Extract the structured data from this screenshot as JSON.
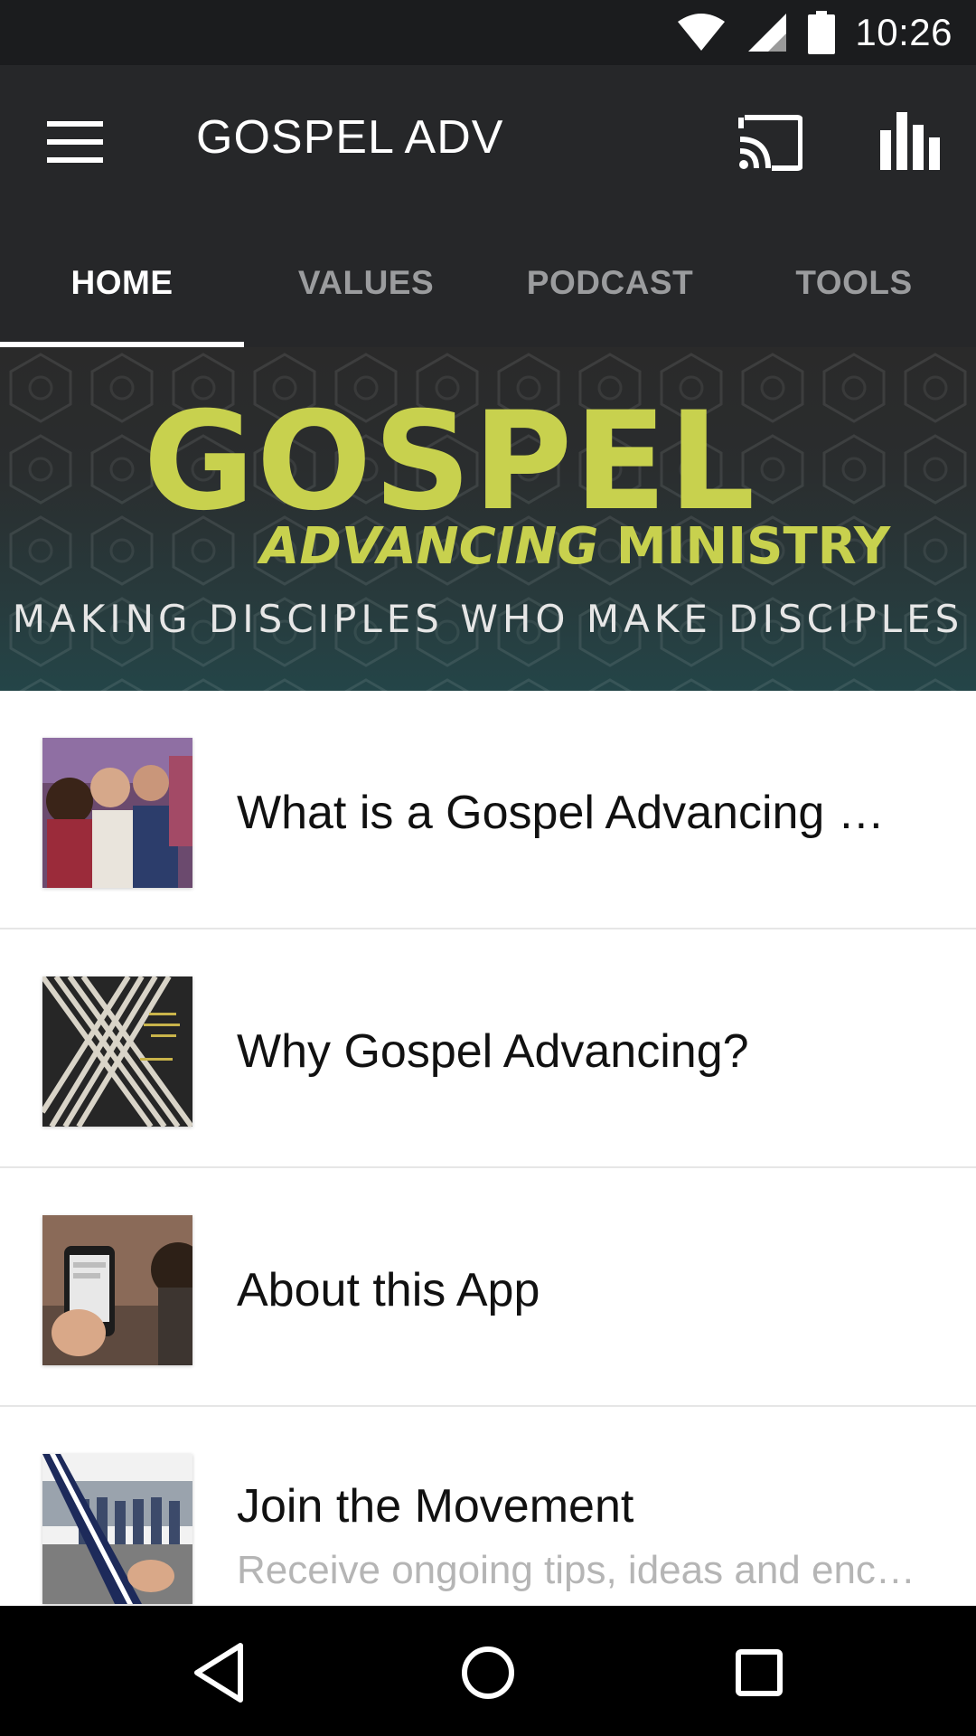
{
  "status_bar": {
    "time": "10:26",
    "icons": [
      "wifi-icon",
      "cell-signal-icon",
      "battery-icon"
    ]
  },
  "app_bar": {
    "title": "GOSPEL ADV",
    "icons": [
      "menu-icon",
      "cast-icon",
      "bar-chart-icon"
    ]
  },
  "tabs": [
    {
      "label": "HOME",
      "active": true
    },
    {
      "label": "VALUES",
      "active": false
    },
    {
      "label": "PODCAST",
      "active": false
    },
    {
      "label": "TOOLS",
      "active": false
    }
  ],
  "banner": {
    "title": "GOSPEL",
    "subtitle_italic": "ADVANCING",
    "subtitle_bold": " MINISTRY",
    "tagline": "MAKING DISCIPLES WHO MAKE DISCIPLES"
  },
  "list_items": [
    {
      "title": "What is a Gospel Advancing Ministry?",
      "subtitle": ""
    },
    {
      "title": "Why Gospel Advancing?",
      "subtitle": ""
    },
    {
      "title": "About this App",
      "subtitle": ""
    },
    {
      "title": "Join the Movement",
      "subtitle": "Receive ongoing tips, ideas and encouragement"
    }
  ],
  "nav_bar": {
    "icons": [
      "back-icon",
      "home-icon",
      "recents-icon"
    ]
  },
  "colors": {
    "app_bar": "#262729",
    "status_bar": "#1b1c1e",
    "accent_green": "#c8d14e",
    "tab_inactive": "#9b9c9e"
  }
}
